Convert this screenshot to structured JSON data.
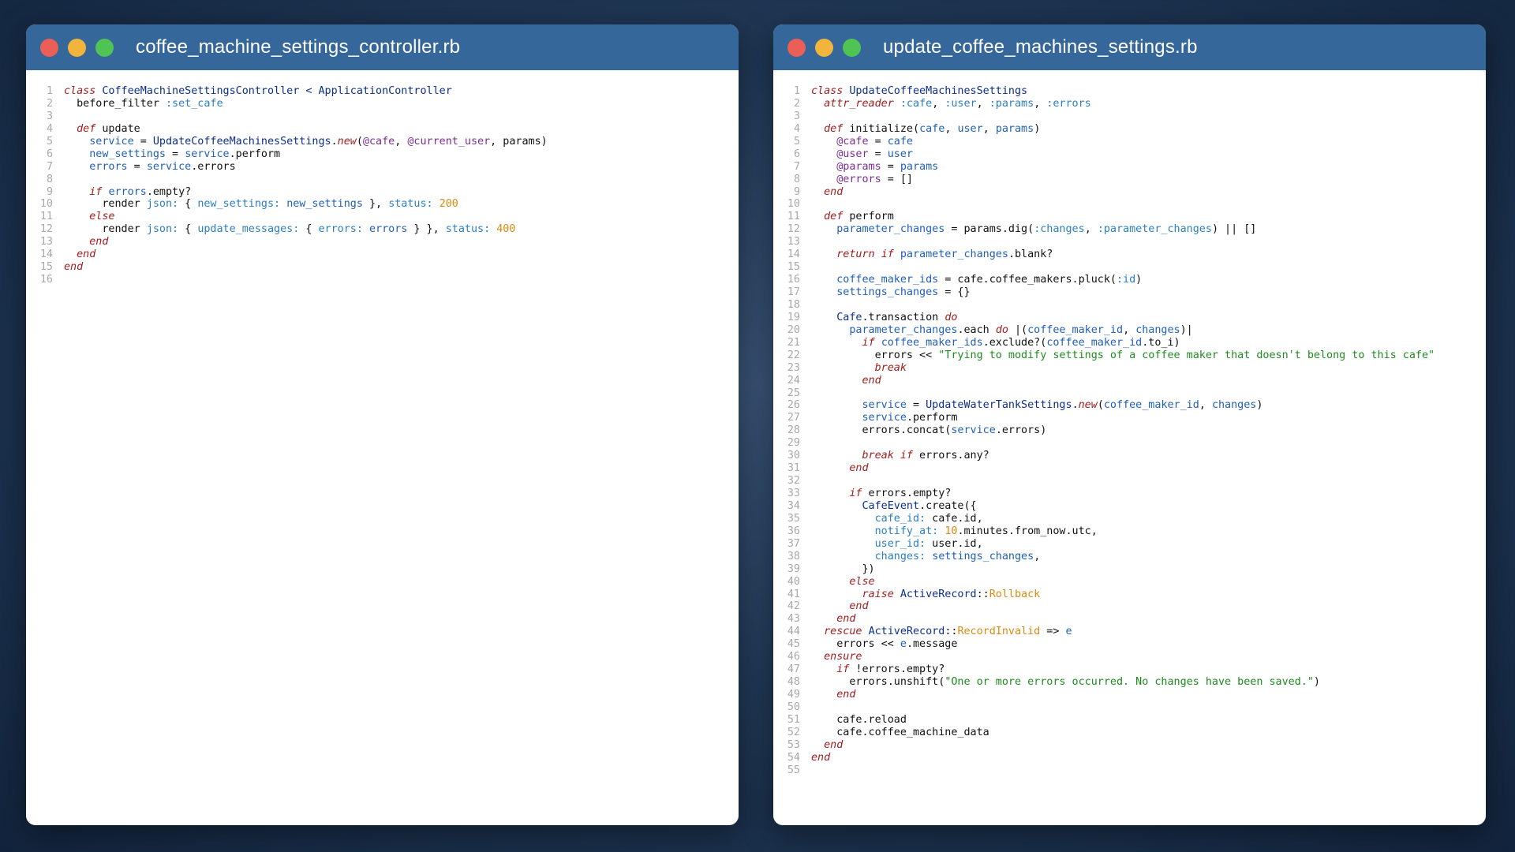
{
  "windows": [
    {
      "title": "coffee_machine_settings_controller.rb",
      "lines": [
        [
          [
            "kw",
            "class"
          ],
          [
            "plain",
            " "
          ],
          [
            "const",
            "CoffeeMachineSettingsController"
          ],
          [
            "plain",
            " "
          ],
          [
            "const",
            "<"
          ],
          [
            "plain",
            " "
          ],
          [
            "const",
            "ApplicationController"
          ]
        ],
        [
          [
            "plain",
            "  before_filter "
          ],
          [
            "sym",
            ":set_cafe"
          ]
        ],
        [],
        [
          [
            "plain",
            "  "
          ],
          [
            "kw",
            "def"
          ],
          [
            "plain",
            " update"
          ]
        ],
        [
          [
            "plain",
            "    "
          ],
          [
            "var",
            "service"
          ],
          [
            "plain",
            " = "
          ],
          [
            "const",
            "UpdateCoffeeMachinesSettings"
          ],
          [
            "plain",
            "."
          ],
          [
            "kw",
            "new"
          ],
          [
            "plain",
            "("
          ],
          [
            "ivar",
            "@cafe"
          ],
          [
            "plain",
            ", "
          ],
          [
            "ivar",
            "@current_user"
          ],
          [
            "plain",
            ", params)"
          ]
        ],
        [
          [
            "plain",
            "    "
          ],
          [
            "var",
            "new_settings"
          ],
          [
            "plain",
            " = "
          ],
          [
            "var",
            "service"
          ],
          [
            "plain",
            ".perform"
          ]
        ],
        [
          [
            "plain",
            "    "
          ],
          [
            "var",
            "errors"
          ],
          [
            "plain",
            " = "
          ],
          [
            "var",
            "service"
          ],
          [
            "plain",
            ".errors"
          ]
        ],
        [],
        [
          [
            "plain",
            "    "
          ],
          [
            "kw",
            "if"
          ],
          [
            "plain",
            " "
          ],
          [
            "var",
            "errors"
          ],
          [
            "plain",
            ".empty?"
          ]
        ],
        [
          [
            "plain",
            "      render "
          ],
          [
            "sym",
            "json:"
          ],
          [
            "plain",
            " { "
          ],
          [
            "sym",
            "new_settings:"
          ],
          [
            "plain",
            " "
          ],
          [
            "var",
            "new_settings"
          ],
          [
            "plain",
            " }, "
          ],
          [
            "sym",
            "status:"
          ],
          [
            "plain",
            " "
          ],
          [
            "num",
            "200"
          ]
        ],
        [
          [
            "plain",
            "    "
          ],
          [
            "kw",
            "else"
          ]
        ],
        [
          [
            "plain",
            "      render "
          ],
          [
            "sym",
            "json:"
          ],
          [
            "plain",
            " { "
          ],
          [
            "sym",
            "update_messages:"
          ],
          [
            "plain",
            " { "
          ],
          [
            "sym",
            "errors:"
          ],
          [
            "plain",
            " "
          ],
          [
            "var",
            "errors"
          ],
          [
            "plain",
            " } }, "
          ],
          [
            "sym",
            "status:"
          ],
          [
            "plain",
            " "
          ],
          [
            "num",
            "400"
          ]
        ],
        [
          [
            "plain",
            "    "
          ],
          [
            "kw",
            "end"
          ]
        ],
        [
          [
            "plain",
            "  "
          ],
          [
            "kw",
            "end"
          ]
        ],
        [
          [
            "kw",
            "end"
          ]
        ],
        []
      ]
    },
    {
      "title": "update_coffee_machines_settings.rb",
      "lines": [
        [
          [
            "kw",
            "class"
          ],
          [
            "plain",
            " "
          ],
          [
            "const",
            "UpdateCoffeeMachinesSettings"
          ]
        ],
        [
          [
            "plain",
            "  "
          ],
          [
            "kw",
            "attr_reader"
          ],
          [
            "plain",
            " "
          ],
          [
            "sym",
            ":cafe"
          ],
          [
            "plain",
            ", "
          ],
          [
            "sym",
            ":user"
          ],
          [
            "plain",
            ", "
          ],
          [
            "sym",
            ":params"
          ],
          [
            "plain",
            ", "
          ],
          [
            "sym",
            ":errors"
          ]
        ],
        [],
        [
          [
            "plain",
            "  "
          ],
          [
            "kw",
            "def"
          ],
          [
            "plain",
            " initialize("
          ],
          [
            "var",
            "cafe"
          ],
          [
            "plain",
            ", "
          ],
          [
            "var",
            "user"
          ],
          [
            "plain",
            ", "
          ],
          [
            "var",
            "params"
          ],
          [
            "plain",
            ")"
          ]
        ],
        [
          [
            "plain",
            "    "
          ],
          [
            "ivar",
            "@cafe"
          ],
          [
            "plain",
            " = "
          ],
          [
            "var",
            "cafe"
          ]
        ],
        [
          [
            "plain",
            "    "
          ],
          [
            "ivar",
            "@user"
          ],
          [
            "plain",
            " = "
          ],
          [
            "var",
            "user"
          ]
        ],
        [
          [
            "plain",
            "    "
          ],
          [
            "ivar",
            "@params"
          ],
          [
            "plain",
            " = "
          ],
          [
            "var",
            "params"
          ]
        ],
        [
          [
            "plain",
            "    "
          ],
          [
            "ivar",
            "@errors"
          ],
          [
            "plain",
            " = []"
          ]
        ],
        [
          [
            "plain",
            "  "
          ],
          [
            "kw",
            "end"
          ]
        ],
        [],
        [
          [
            "plain",
            "  "
          ],
          [
            "kw",
            "def"
          ],
          [
            "plain",
            " perform"
          ]
        ],
        [
          [
            "plain",
            "    "
          ],
          [
            "var",
            "parameter_changes"
          ],
          [
            "plain",
            " = params.dig("
          ],
          [
            "sym",
            ":changes"
          ],
          [
            "plain",
            ", "
          ],
          [
            "sym",
            ":parameter_changes"
          ],
          [
            "plain",
            ") || []"
          ]
        ],
        [],
        [
          [
            "plain",
            "    "
          ],
          [
            "kw",
            "return"
          ],
          [
            "plain",
            " "
          ],
          [
            "kw",
            "if"
          ],
          [
            "plain",
            " "
          ],
          [
            "var",
            "parameter_changes"
          ],
          [
            "plain",
            ".blank?"
          ]
        ],
        [],
        [
          [
            "plain",
            "    "
          ],
          [
            "var",
            "coffee_maker_ids"
          ],
          [
            "plain",
            " = cafe.coffee_makers.pluck("
          ],
          [
            "sym",
            ":id"
          ],
          [
            "plain",
            ")"
          ]
        ],
        [
          [
            "plain",
            "    "
          ],
          [
            "var",
            "settings_changes"
          ],
          [
            "plain",
            " = {}"
          ]
        ],
        [],
        [
          [
            "plain",
            "    "
          ],
          [
            "const",
            "Cafe"
          ],
          [
            "plain",
            ".transaction "
          ],
          [
            "kw",
            "do"
          ]
        ],
        [
          [
            "plain",
            "      "
          ],
          [
            "var",
            "parameter_changes"
          ],
          [
            "plain",
            ".each "
          ],
          [
            "kw",
            "do"
          ],
          [
            "plain",
            " |("
          ],
          [
            "var",
            "coffee_maker_id"
          ],
          [
            "plain",
            ", "
          ],
          [
            "var",
            "changes"
          ],
          [
            "plain",
            ")|"
          ]
        ],
        [
          [
            "plain",
            "        "
          ],
          [
            "kw",
            "if"
          ],
          [
            "plain",
            " "
          ],
          [
            "var",
            "coffee_maker_ids"
          ],
          [
            "plain",
            ".exclude?("
          ],
          [
            "var",
            "coffee_maker_id"
          ],
          [
            "plain",
            ".to_i)"
          ]
        ],
        [
          [
            "plain",
            "          errors << "
          ],
          [
            "str",
            "\"Trying to modify settings of a coffee maker that doesn't belong to this cafe\""
          ]
        ],
        [
          [
            "plain",
            "          "
          ],
          [
            "kw",
            "break"
          ]
        ],
        [
          [
            "plain",
            "        "
          ],
          [
            "kw",
            "end"
          ]
        ],
        [],
        [
          [
            "plain",
            "        "
          ],
          [
            "var",
            "service"
          ],
          [
            "plain",
            " = "
          ],
          [
            "const",
            "UpdateWaterTankSettings"
          ],
          [
            "plain",
            "."
          ],
          [
            "kw",
            "new"
          ],
          [
            "plain",
            "("
          ],
          [
            "var",
            "coffee_maker_id"
          ],
          [
            "plain",
            ", "
          ],
          [
            "var",
            "changes"
          ],
          [
            "plain",
            ")"
          ]
        ],
        [
          [
            "plain",
            "        "
          ],
          [
            "var",
            "service"
          ],
          [
            "plain",
            ".perform"
          ]
        ],
        [
          [
            "plain",
            "        errors.concat("
          ],
          [
            "var",
            "service"
          ],
          [
            "plain",
            ".errors)"
          ]
        ],
        [],
        [
          [
            "plain",
            "        "
          ],
          [
            "kw",
            "break"
          ],
          [
            "plain",
            " "
          ],
          [
            "kw",
            "if"
          ],
          [
            "plain",
            " errors.any?"
          ]
        ],
        [
          [
            "plain",
            "      "
          ],
          [
            "kw",
            "end"
          ]
        ],
        [],
        [
          [
            "plain",
            "      "
          ],
          [
            "kw",
            "if"
          ],
          [
            "plain",
            " errors.empty?"
          ]
        ],
        [
          [
            "plain",
            "        "
          ],
          [
            "const",
            "CafeEvent"
          ],
          [
            "plain",
            ".create({"
          ]
        ],
        [
          [
            "plain",
            "          "
          ],
          [
            "sym",
            "cafe_id:"
          ],
          [
            "plain",
            " cafe.id,"
          ]
        ],
        [
          [
            "plain",
            "          "
          ],
          [
            "sym",
            "notify_at:"
          ],
          [
            "plain",
            " "
          ],
          [
            "num",
            "10"
          ],
          [
            "plain",
            ".minutes.from_now.utc,"
          ]
        ],
        [
          [
            "plain",
            "          "
          ],
          [
            "sym",
            "user_id:"
          ],
          [
            "plain",
            " user.id,"
          ]
        ],
        [
          [
            "plain",
            "          "
          ],
          [
            "sym",
            "changes:"
          ],
          [
            "plain",
            " "
          ],
          [
            "var",
            "settings_changes"
          ],
          [
            "plain",
            ","
          ]
        ],
        [
          [
            "plain",
            "        })"
          ]
        ],
        [
          [
            "plain",
            "      "
          ],
          [
            "kw",
            "else"
          ]
        ],
        [
          [
            "plain",
            "        "
          ],
          [
            "kw",
            "raise"
          ],
          [
            "plain",
            " "
          ],
          [
            "const",
            "ActiveRecord"
          ],
          [
            "plain",
            "::"
          ],
          [
            "class2",
            "Rollback"
          ]
        ],
        [
          [
            "plain",
            "      "
          ],
          [
            "kw",
            "end"
          ]
        ],
        [
          [
            "plain",
            "    "
          ],
          [
            "kw",
            "end"
          ]
        ],
        [
          [
            "plain",
            "  "
          ],
          [
            "kw",
            "rescue"
          ],
          [
            "plain",
            " "
          ],
          [
            "const",
            "ActiveRecord"
          ],
          [
            "plain",
            "::"
          ],
          [
            "class2",
            "RecordInvalid"
          ],
          [
            "plain",
            " => "
          ],
          [
            "var",
            "e"
          ]
        ],
        [
          [
            "plain",
            "    errors << "
          ],
          [
            "var",
            "e"
          ],
          [
            "plain",
            ".message"
          ]
        ],
        [
          [
            "plain",
            "  "
          ],
          [
            "kw",
            "ensure"
          ]
        ],
        [
          [
            "plain",
            "    "
          ],
          [
            "kw",
            "if"
          ],
          [
            "plain",
            " !errors.empty?"
          ]
        ],
        [
          [
            "plain",
            "      errors.unshift("
          ],
          [
            "str",
            "\"One or more errors occurred. No changes have been saved.\""
          ],
          [
            "plain",
            ")"
          ]
        ],
        [
          [
            "plain",
            "    "
          ],
          [
            "kw",
            "end"
          ]
        ],
        [],
        [
          [
            "plain",
            "    cafe.reload"
          ]
        ],
        [
          [
            "plain",
            "    cafe.coffee_machine_data"
          ]
        ],
        [
          [
            "plain",
            "  "
          ],
          [
            "kw",
            "end"
          ]
        ],
        [
          [
            "kw",
            "end"
          ]
        ],
        []
      ]
    }
  ]
}
